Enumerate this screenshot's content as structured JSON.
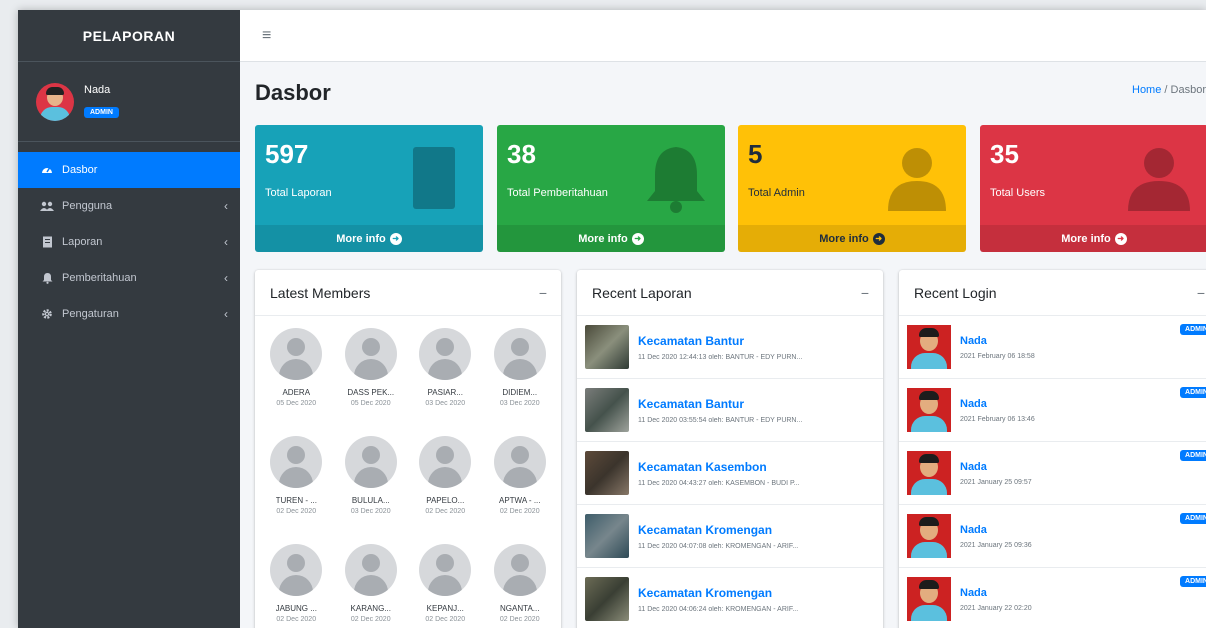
{
  "sidebar": {
    "brand": "PELAPORAN",
    "user": {
      "name": "Nada",
      "badge": "ADMIN"
    },
    "items": [
      {
        "label": "Dasbor",
        "icon": "dashboard-icon",
        "active": true
      },
      {
        "label": "Pengguna",
        "icon": "users-icon"
      },
      {
        "label": "Laporan",
        "icon": "report-icon"
      },
      {
        "label": "Pemberitahuan",
        "icon": "bell-icon"
      },
      {
        "label": "Pengaturan",
        "icon": "gear-icon"
      }
    ]
  },
  "header": {
    "menu_icon": "hamburger-icon"
  },
  "page": {
    "title": "Dasbor",
    "breadcrumb": {
      "home": "Home",
      "separator": "/",
      "current": "Dasbor"
    }
  },
  "stats": [
    {
      "value": "597",
      "label": "Total Laporan",
      "more": "More info",
      "color": "#17a2b8",
      "icon": "document-icon"
    },
    {
      "value": "38",
      "label": "Total Pemberitahuan",
      "more": "More info",
      "color": "#28a745",
      "icon": "bell-icon"
    },
    {
      "value": "5",
      "label": "Total Admin",
      "more": "More info",
      "color": "#ffc107",
      "icon": "admin-user-icon"
    },
    {
      "value": "35",
      "label": "Total Users",
      "more": "More info",
      "color": "#dc3545",
      "icon": "user-icon"
    }
  ],
  "members": {
    "title": "Latest Members",
    "items": [
      {
        "name": "ADERA",
        "date": "05 Dec 2020"
      },
      {
        "name": "DASS PEK...",
        "date": "05 Dec 2020"
      },
      {
        "name": "PASIAR...",
        "date": "03 Dec 2020"
      },
      {
        "name": "DIDIEM...",
        "date": "03 Dec 2020"
      },
      {
        "name": "TUREN - ...",
        "date": "02 Dec 2020"
      },
      {
        "name": "BULULA...",
        "date": "03 Dec 2020"
      },
      {
        "name": "PAPELO...",
        "date": "02 Dec 2020"
      },
      {
        "name": "APTWA - ...",
        "date": "02 Dec 2020"
      },
      {
        "name": "JABUNG ...",
        "date": "02 Dec 2020"
      },
      {
        "name": "KARANG...",
        "date": "02 Dec 2020"
      },
      {
        "name": "KEPANJ...",
        "date": "02 Dec 2020"
      },
      {
        "name": "NGANTA...",
        "date": "02 Dec 2020"
      }
    ]
  },
  "reports": {
    "title": "Recent Laporan",
    "items": [
      {
        "title": "Kecamatan Bantur",
        "desc": "11 Dec 2020 12:44:13 oleh: BANTUR - EDY PURN..."
      },
      {
        "title": "Kecamatan Bantur",
        "desc": "11 Dec 2020 03:55:54 oleh: BANTUR - EDY PURN..."
      },
      {
        "title": "Kecamatan Kasembon",
        "desc": "11 Dec 2020 04:43:27 oleh: KASEMBON - BUDI P..."
      },
      {
        "title": "Kecamatan Kromengan",
        "desc": "11 Dec 2020 04:07:08 oleh: KROMENGAN - ARIF..."
      },
      {
        "title": "Kecamatan Kromengan",
        "desc": "11 Dec 2020 04:06:24 oleh: KROMENGAN - ARIF..."
      }
    ]
  },
  "logins": {
    "title": "Recent Login",
    "items": [
      {
        "name": "Nada",
        "time": "2021 February 06 18:58",
        "badge": "ADMIN"
      },
      {
        "name": "Nada",
        "time": "2021 February 06 13:46",
        "badge": "ADMIN"
      },
      {
        "name": "Nada",
        "time": "2021 January 25 09:57",
        "badge": "ADMIN"
      },
      {
        "name": "Nada",
        "time": "2021 January 25 09:36",
        "badge": "ADMIN"
      },
      {
        "name": "Nada",
        "time": "2021 January 22 02:20",
        "badge": "ADMIN"
      }
    ]
  }
}
